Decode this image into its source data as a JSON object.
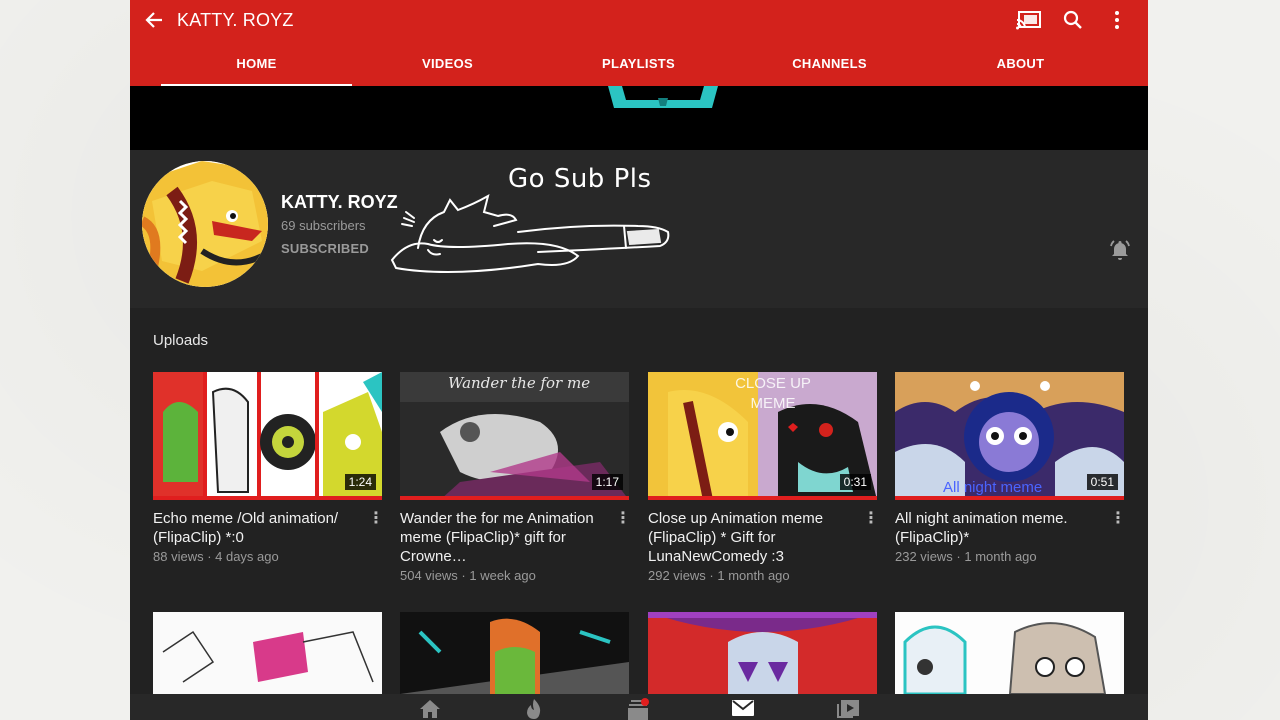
{
  "appbar": {
    "title": "KATTY. ROYZ",
    "back_icon": "arrow-left-icon",
    "action_icons": [
      "cast-icon",
      "search-icon",
      "more-vert-icon"
    ],
    "background": "#d3221c"
  },
  "tabs": [
    {
      "label": "HOME",
      "active": true
    },
    {
      "label": "VIDEOS",
      "active": false
    },
    {
      "label": "PLAYLISTS",
      "active": false
    },
    {
      "label": "CHANNELS",
      "active": false
    },
    {
      "label": "ABOUT",
      "active": false
    }
  ],
  "channel": {
    "name": "KATTY. ROYZ",
    "subscribers": "69 subscribers",
    "status": "SUBSCRIBED",
    "doodle_text": "Go Sub Pls",
    "bell_icon": "bell-ring-icon"
  },
  "uploads": {
    "title": "Uploads",
    "videos": [
      {
        "title": "Echo meme /Old animation/ (FlipaClip) *:0",
        "meta": "88 views · 4 days ago",
        "duration": "1:24"
      },
      {
        "title": "Wander the for me Animation meme (FlipaClip)* gift for Crowne…",
        "meta": "504 views · 1 week ago",
        "duration": "1:17",
        "thumb_text": "Wander the for me"
      },
      {
        "title": "Close up Animation meme (FlipaClip) * Gift for LunaNewComedy :3",
        "meta": "292 views · 1 month ago",
        "duration": "0:31",
        "thumb_text": "CLOSE UP MEME"
      },
      {
        "title": "All night animation meme. (FlipaClip)*",
        "meta": "232 views · 1 month ago",
        "duration": "0:51",
        "thumb_text": "All night meme"
      }
    ]
  },
  "bottom_nav": [
    "home-icon",
    "trending-icon",
    "subscriptions-icon",
    "inbox-icon",
    "library-icon"
  ],
  "colors": {
    "accent": "#d3221c",
    "progress": "#e01e1e",
    "background": "#222222"
  }
}
